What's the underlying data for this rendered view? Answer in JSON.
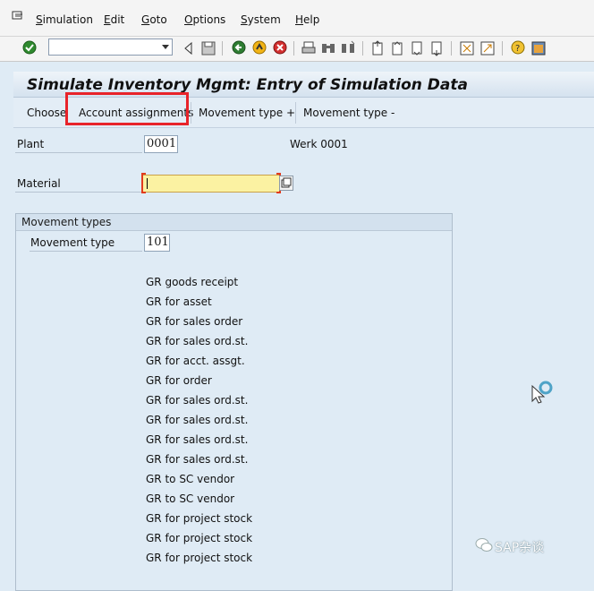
{
  "menubar": {
    "items": [
      {
        "label": "Simulation",
        "u": "S",
        "rest": "imulation"
      },
      {
        "label": "Edit",
        "u": "E",
        "rest": "dit"
      },
      {
        "label": "Goto",
        "u": "G",
        "rest": "oto"
      },
      {
        "label": "Options",
        "u": "O",
        "rest": "ptions"
      },
      {
        "label": "System",
        "u": "S",
        "rest": "ystem"
      },
      {
        "label": "Help",
        "u": "H",
        "rest": "elp"
      }
    ]
  },
  "toolbar": {
    "icons": [
      "enter-icon",
      "command-field",
      "back-nav-icon",
      "save-icon",
      "back-icon",
      "exit-icon",
      "cancel-icon",
      "print-icon",
      "find-icon",
      "find-next-icon",
      "first-page-icon",
      "previous-page-icon",
      "next-page-icon",
      "last-page-icon",
      "create-session-icon",
      "shortcut-icon",
      "help-icon",
      "layout-menu-icon"
    ]
  },
  "title": "Simulate Inventory Mgmt: Entry of Simulation Data",
  "appbar": {
    "choose": "Choose",
    "account_assignments": "Account assignments",
    "movement_type_plus": "Movement type +",
    "movement_type_minus": "Movement type -"
  },
  "form": {
    "plant_label": "Plant",
    "plant_value": "0001",
    "plant_desc": "Werk 0001",
    "material_label": "Material",
    "material_value": ""
  },
  "movement_types": {
    "group_title": "Movement types",
    "label": "Movement type",
    "value": "101",
    "lines": [
      "GR goods receipt",
      "GR for asset",
      "GR for sales order",
      "GR for sales ord.st.",
      "GR for acct. assgt.",
      "GR for order",
      "GR for sales ord.st.",
      "GR for sales ord.st.",
      "GR for sales ord.st.",
      "GR for sales ord.st.",
      "GR to SC vendor",
      "GR to SC vendor",
      "GR for project stock",
      "GR for project stock",
      "GR for project stock"
    ]
  },
  "watermark": "SAP杂谈",
  "colors": {
    "highlight": "#e8232a",
    "required_field": "#fbf2a2"
  }
}
